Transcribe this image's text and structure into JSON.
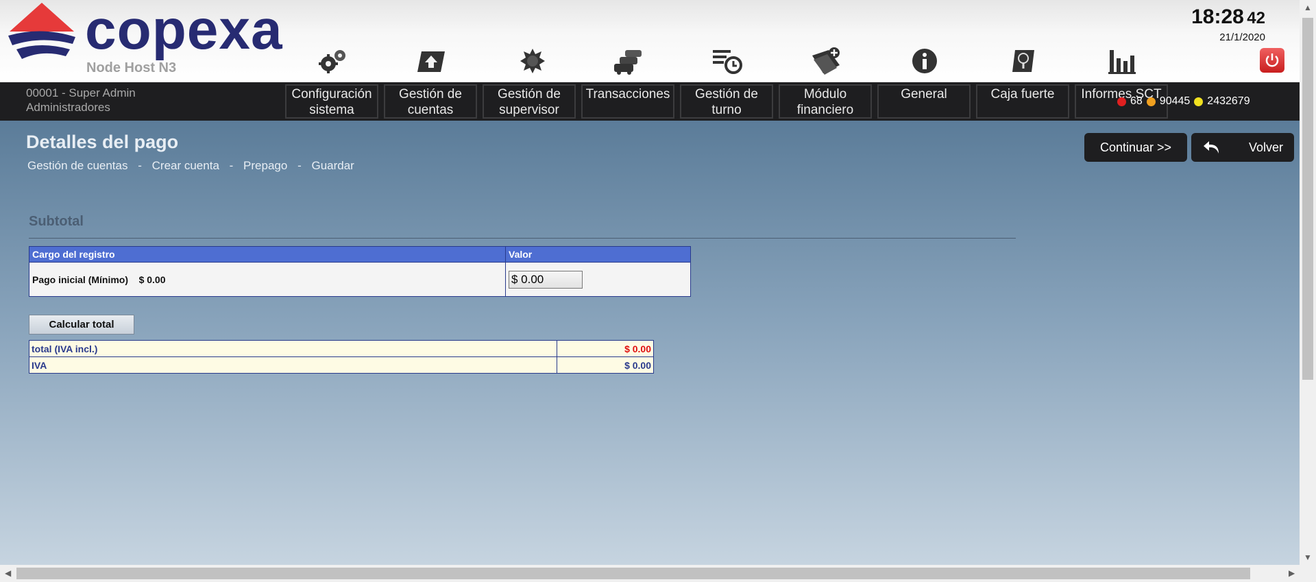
{
  "header": {
    "brand": "copexa",
    "node_host": "Node Host N3",
    "time": "18:28",
    "seconds": "42",
    "date": "21/1/2020",
    "icons": [
      "gears-icon",
      "card-upload-icon",
      "sun-badge-icon",
      "traffic-cars-icon",
      "shift-clock-icon",
      "wallet-plus-icon",
      "info-icon",
      "safe-icon",
      "bar-chart-icon",
      "power-icon"
    ]
  },
  "nav": {
    "user_id": "00001 - Super Admin",
    "user_group": "Administradores",
    "items": [
      {
        "line1": "Configuración",
        "line2": "sistema"
      },
      {
        "line1": "Gestión de",
        "line2": "cuentas"
      },
      {
        "line1": "Gestión de",
        "line2": "supervisor"
      },
      {
        "line1": "Transacciones",
        "line2": ""
      },
      {
        "line1": "Gestión de",
        "line2": "turno"
      },
      {
        "line1": "Módulo",
        "line2": "financiero"
      },
      {
        "line1": "General",
        "line2": ""
      },
      {
        "line1": "Caja fuerte",
        "line2": ""
      },
      {
        "line1": "Informes SCT",
        "line2": ""
      }
    ],
    "counter_red": "68",
    "counter_orange": "90445",
    "counter_yellow": "2432679",
    "colors": {
      "red": "#e02020",
      "orange": "#f0a020",
      "yellow": "#f0e020"
    }
  },
  "page": {
    "title": "Detalles del pago",
    "breadcrumb": [
      "Gestión de cuentas",
      "-",
      "Crear cuenta",
      "-",
      "Prepago",
      "-",
      "Guardar"
    ],
    "continue_label": "Continuar >>",
    "back_label": "Volver",
    "section_title": "Subtotal"
  },
  "cargo_table": {
    "col_cargo": "Cargo del registro",
    "col_valor": "Valor",
    "row_label": "Pago inicial (Mínimo)",
    "row_amount": "$ 0.00",
    "input_value": "$ 0.00"
  },
  "calc_label": "Calcular total",
  "totals": {
    "total_label": "total (IVA incl.)",
    "total_value": "$ 0.00",
    "iva_label": "IVA",
    "iva_value": "$ 0.00"
  }
}
